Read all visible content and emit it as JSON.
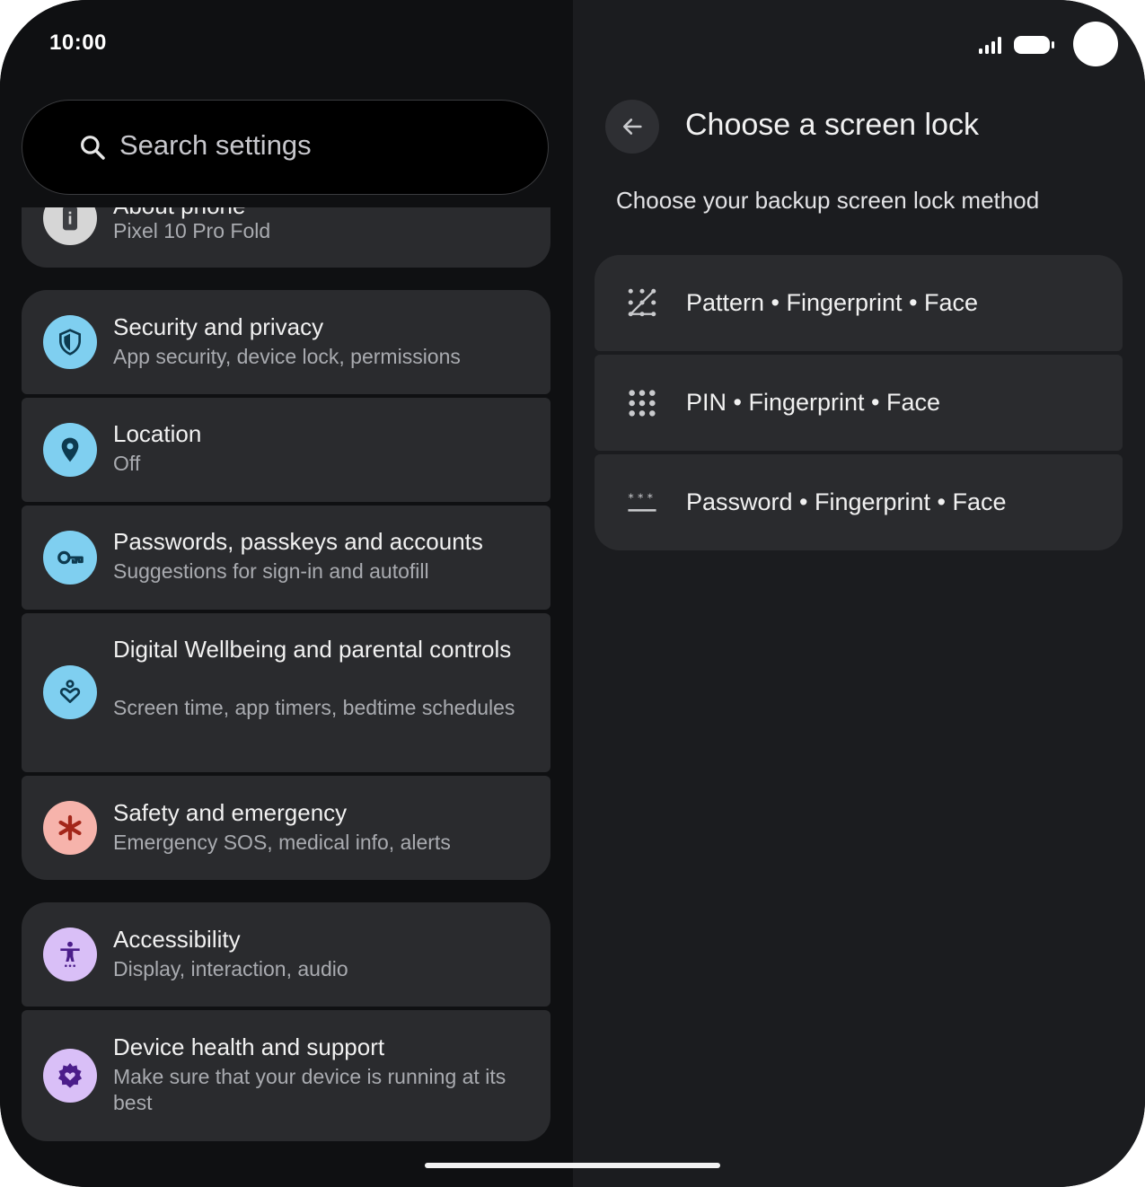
{
  "status_bar": {
    "time": "10:00",
    "icons": [
      "signal-icon",
      "battery-icon"
    ]
  },
  "search": {
    "placeholder": "Search settings",
    "icon": "search-icon"
  },
  "settings_list": [
    {
      "id": "about",
      "title": "About phone",
      "subtitle": "Pixel 10 Pro Fold",
      "icon": "info-phone-icon",
      "icon_bg": "#d6d6d6"
    },
    {
      "id": "security",
      "title": "Security and privacy",
      "subtitle": "App security, device lock, permissions",
      "icon": "shield-icon",
      "icon_bg": "#7fcff0"
    },
    {
      "id": "location",
      "title": "Location",
      "subtitle": "Off",
      "icon": "location-pin-icon",
      "icon_bg": "#7fcff0"
    },
    {
      "id": "passwords",
      "title": "Passwords, passkeys and accounts",
      "subtitle": "Suggestions for sign-in and autofill",
      "icon": "key-icon",
      "icon_bg": "#7fcff0"
    },
    {
      "id": "wellbeing",
      "title": "Digital Wellbeing and parental controls",
      "subtitle": "Screen time, app timers, bedtime schedules",
      "icon": "wellbeing-heart-icon",
      "icon_bg": "#7fcff0"
    },
    {
      "id": "safety",
      "title": "Safety and emergency",
      "subtitle": "Emergency SOS, medical info, alerts",
      "icon": "asterisk-icon",
      "icon_bg": "#f6b3ab"
    },
    {
      "id": "accessibility",
      "title": "Accessibility",
      "subtitle": "Display, interaction, audio",
      "icon": "accessibility-icon",
      "icon_bg": "#d9bff7"
    },
    {
      "id": "device_health",
      "title": "Device health and support",
      "subtitle": "Make sure that your device is running at its best",
      "icon": "gear-heart-icon",
      "icon_bg": "#d9bff7"
    }
  ],
  "right_pane": {
    "back_icon": "arrow-back-icon",
    "title": "Choose a screen lock",
    "subtitle": "Choose your backup screen lock method",
    "options": [
      {
        "label": "Pattern • Fingerprint • Face",
        "icon": "pattern-icon"
      },
      {
        "label": "PIN • Fingerprint • Face",
        "icon": "pin-dots-icon"
      },
      {
        "label": "Password • Fingerprint • Face",
        "icon": "password-icon"
      }
    ]
  },
  "colors": {
    "accent_blue": "#7fcff0",
    "accent_red": "#f6b3ab",
    "accent_purple": "#d9bff7",
    "card_bg": "#2a2b2e"
  }
}
